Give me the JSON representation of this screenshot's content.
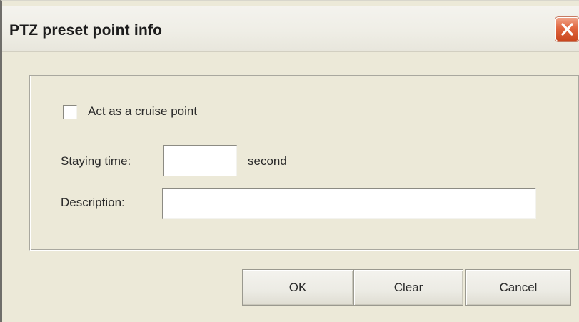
{
  "window": {
    "title": "PTZ preset point info"
  },
  "titlebar_buttons": {
    "close_icon": "close-x-icon"
  },
  "form": {
    "cruise_checkbox_label": "Act as a cruise point",
    "cruise_checkbox_checked": false,
    "staying_time_label": "Staying time:",
    "staying_time_value": "",
    "staying_time_unit": "second",
    "description_label": "Description:",
    "description_value": ""
  },
  "buttons": {
    "ok_label": "OK",
    "clear_label": "Clear",
    "cancel_label": "Cancel"
  },
  "colors": {
    "dialog_background": "#ece9d8",
    "close_button": "#e0663f"
  }
}
